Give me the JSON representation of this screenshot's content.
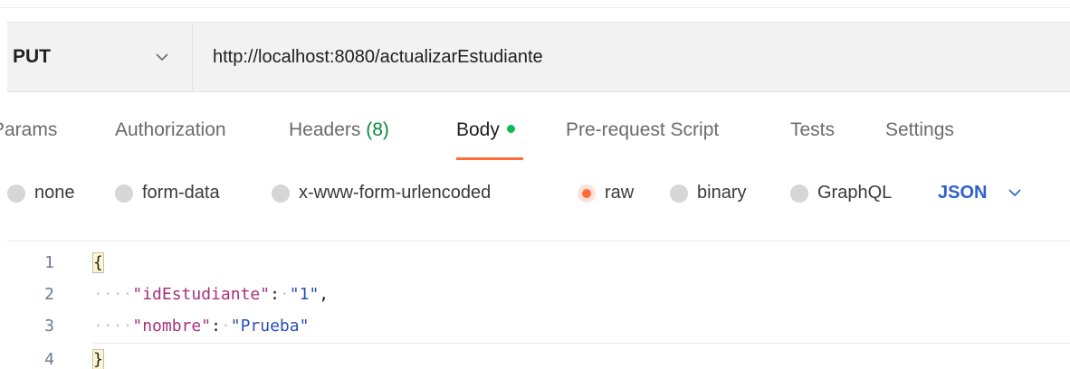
{
  "request": {
    "method": "PUT",
    "url": "http://localhost:8080/actualizarEstudiante"
  },
  "tabs": [
    {
      "label": "Params"
    },
    {
      "label": "Authorization"
    },
    {
      "label": "Headers",
      "count": "(8)"
    },
    {
      "label": "Body",
      "active": true,
      "indicator_color": "#0cbb52"
    },
    {
      "label": "Pre-request Script"
    },
    {
      "label": "Tests"
    },
    {
      "label": "Settings"
    }
  ],
  "body_types": [
    {
      "label": "none",
      "selected": false
    },
    {
      "label": "form-data",
      "selected": false
    },
    {
      "label": "x-www-form-urlencoded",
      "selected": false
    },
    {
      "label": "raw",
      "selected": true
    },
    {
      "label": "binary",
      "selected": false
    },
    {
      "label": "GraphQL",
      "selected": false
    }
  ],
  "raw_language": "JSON",
  "editor": {
    "line_numbers": [
      "1",
      "2",
      "3",
      "4"
    ],
    "open_brace": "{",
    "close_brace": "}",
    "indent_dots": "····",
    "fields": [
      {
        "key": "\"idEstudiante\"",
        "colon": ":",
        "value": "\"1\"",
        "comma": ","
      },
      {
        "key": "\"nombre\"",
        "colon": ":",
        "value": "\"Prueba\"",
        "comma": ""
      }
    ]
  },
  "colors": {
    "accent": "#ff6c37",
    "json_blue": "#2f5fd0",
    "key_color": "#a6317b",
    "string_color": "#2b4eb5"
  },
  "icons": {
    "method_dropdown": "chevron-down-icon",
    "language_dropdown": "chevron-down-icon"
  }
}
